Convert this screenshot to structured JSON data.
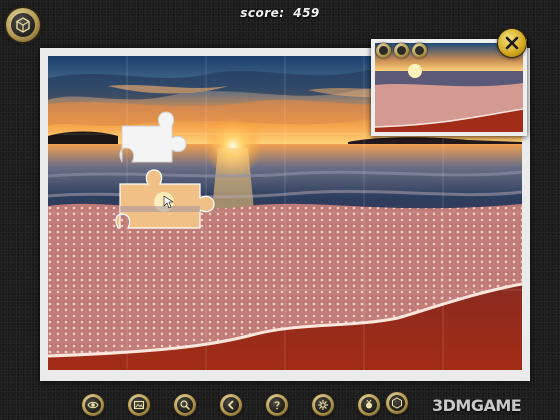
{
  "hud": {
    "score_label": "score:",
    "score_value": "459",
    "menu_icon": "cube-icon",
    "close_icon": "close-icon"
  },
  "preview": {
    "buttons": [
      {
        "icon": "toggle-icon"
      },
      {
        "icon": "zoom-icon"
      },
      {
        "icon": "size-icon"
      }
    ]
  },
  "toolbar": {
    "buttons": [
      {
        "name": "eye-button",
        "icon": "eye-icon"
      },
      {
        "name": "picture-button",
        "icon": "picture-icon"
      },
      {
        "name": "magnifier-button",
        "icon": "magnifier-icon"
      },
      {
        "name": "back-button",
        "icon": "arrow-left-icon"
      },
      {
        "name": "hint-button",
        "icon": "question-icon"
      },
      {
        "name": "settings-button",
        "icon": "gear-icon"
      },
      {
        "name": "extra-button",
        "icon": "medal-icon"
      },
      {
        "name": "menu-button",
        "icon": "cube-icon"
      }
    ]
  },
  "watermark": "3DMGAME",
  "colors": {
    "sky_top": "#1d4a78",
    "sunset": "#f08a2c",
    "sand": "#a12c18",
    "foam": "#f3cfc0",
    "gold_button": "#b49a52",
    "close_yellow": "#e0b52a"
  }
}
